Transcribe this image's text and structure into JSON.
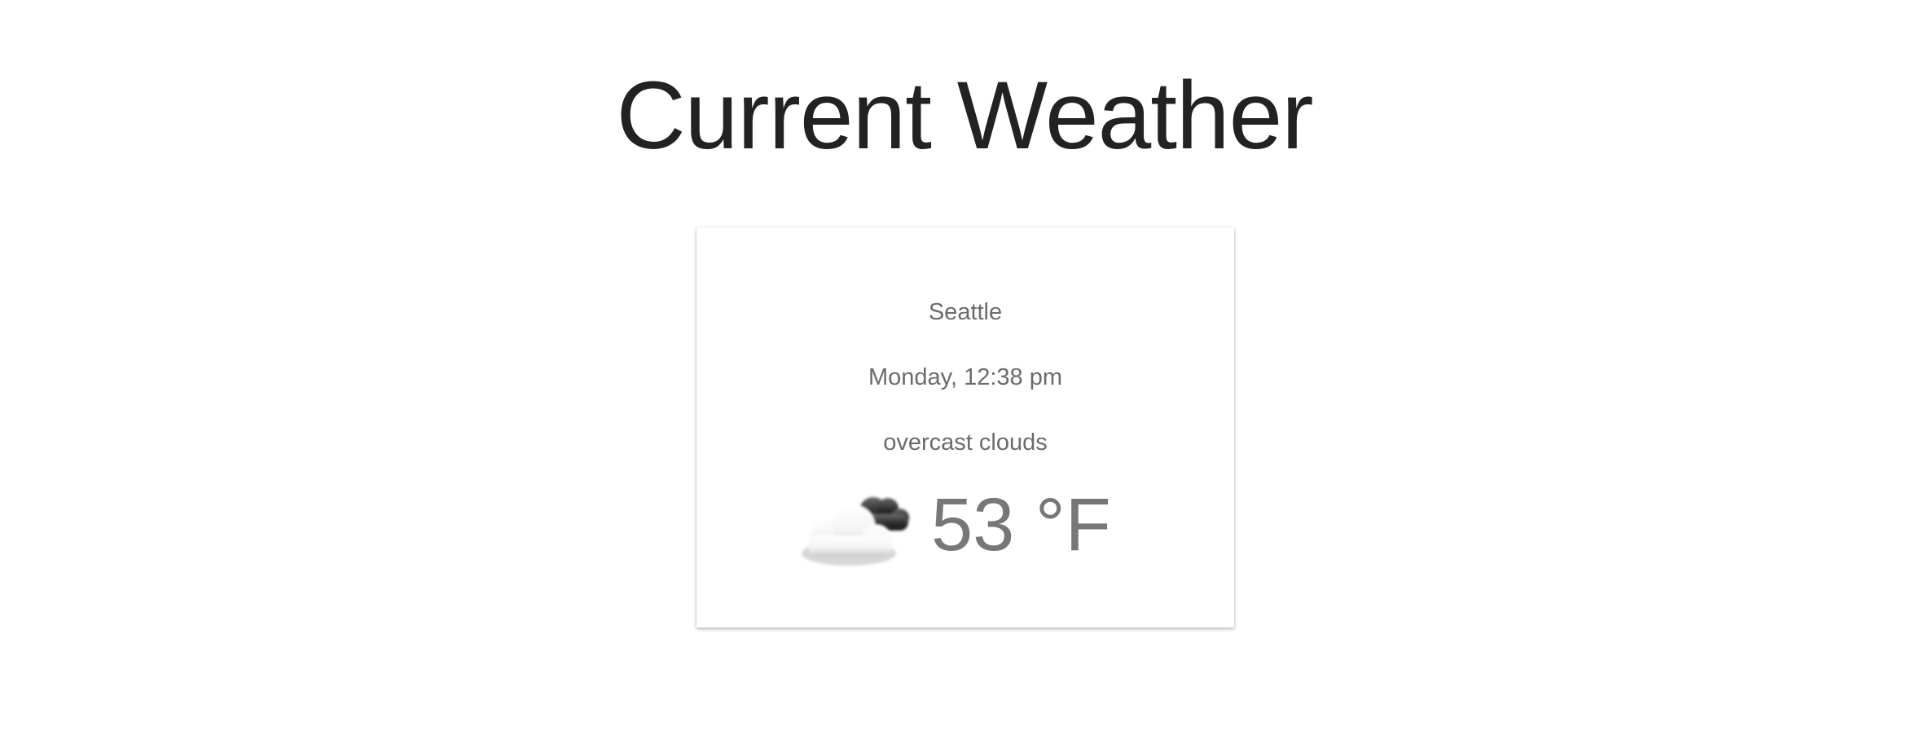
{
  "page": {
    "title": "Current Weather"
  },
  "weather": {
    "city": "Seattle",
    "datetime": "Monday, 12:38 pm",
    "description": "overcast clouds",
    "temperature": "53 °F",
    "icon": "overcast-clouds-icon"
  },
  "colors": {
    "title": "#222222",
    "card_text": "#6b6b6b",
    "temperature": "#777777",
    "background": "#ffffff"
  }
}
